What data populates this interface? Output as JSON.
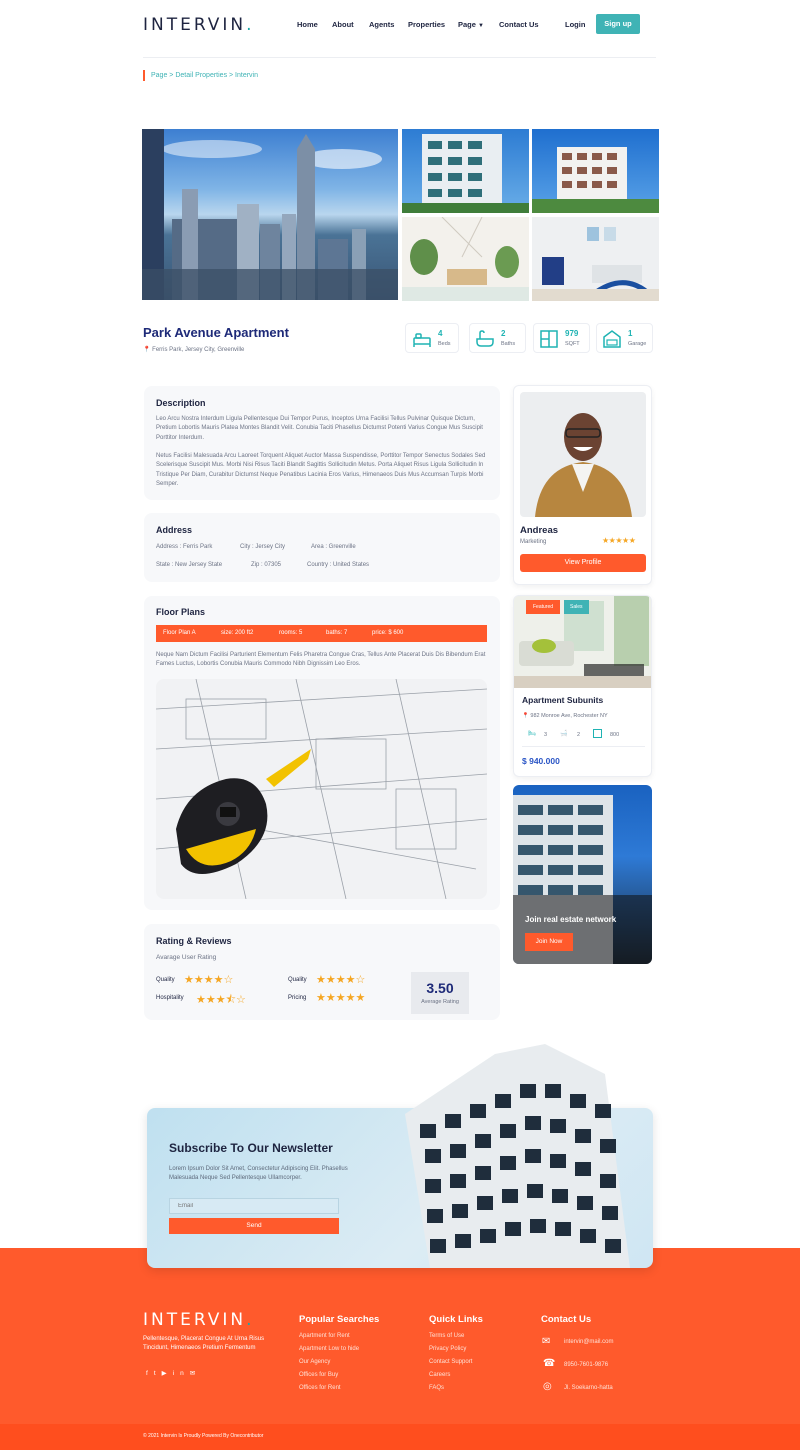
{
  "header": {
    "logo": "INTERVIN",
    "logo_dot": ".",
    "nav": [
      "Home",
      "About",
      "Agents",
      "Properties",
      "Page",
      "Contact Us"
    ],
    "login": "Login",
    "signup": "Sign up"
  },
  "breadcrumb": "Page > Detail Properties > Intervin",
  "property": {
    "title": "Park Avenue Apartment",
    "location": "Ferris Park, Jersey City, Greenville",
    "features": [
      {
        "value": "4",
        "label": "Beds",
        "icon": "bed-icon"
      },
      {
        "value": "2",
        "label": "Baths",
        "icon": "bath-icon"
      },
      {
        "value": "979",
        "label": "SQFT",
        "icon": "area-icon"
      },
      {
        "value": "1",
        "label": "Garage",
        "icon": "garage-icon"
      }
    ]
  },
  "description": {
    "title": "Description",
    "p1": "Leo Arcu Nostra Interdum Ligula Pellentesque Dui Tempor Purus, Inceptos Urna Facilisi Tellus Pulvinar Quisque Dictum, Pretium Lobortis Mauris Platea Montes Blandit Velit. Conubia Taciti Phasellus Dictumst Potenti Varius Congue Mus Suscipit Porttitor Interdum.",
    "p2": "Netus Facilisi Malesuada Arcu Laoreet Torquent Aliquet Auctor Massa Suspendisse, Porttitor Tempor Senectus Sodales Sed Scelerisque Suscipit Mus. Morbi Nisi Risus Taciti Blandit Sagittis Sollicitudin Metus. Porta Aliquet Risus Ligula Sollicitudin In Tristique Per Diam, Curabitur Dictumst Neque Penatibus Lacinia Eros Varius, Himenaeos Duis Mus Accumsan Turpis Morbi Semper."
  },
  "address": {
    "title": "Address",
    "row1": [
      "Address : Ferris Park",
      "City : Jersey City",
      "Area : Greenville"
    ],
    "row2": [
      "State : New Jersey State",
      "Zip : 07305",
      "Country : United States"
    ]
  },
  "floor": {
    "title": "Floor Plans",
    "bar": [
      "Floor Plan A",
      "size: 200 ft2",
      "rooms: 5",
      "baths: 7",
      "price: $ 600"
    ],
    "text": "Neque Nam Dictum Facilisi Parturient Elementum Felis Pharetra Congue Cras, Tellus Ante Placerat Duis Dis Bibendum Erat Fames Luctus, Lobortis Conubia Mauris Commodo Nibh Dignissim Leo Eros."
  },
  "rating": {
    "title": "Rating & Reviews",
    "subtitle": "Avarage User Rating",
    "items": [
      {
        "label": "Quality",
        "value": 4
      },
      {
        "label": "Quality",
        "value": 4
      },
      {
        "label": "Hospitality",
        "value": 3.5
      },
      {
        "label": "Pricing",
        "value": 5
      }
    ],
    "score": "3.50",
    "score_label": "Average Rating"
  },
  "agent": {
    "name": "Andreas",
    "role": "Marketing",
    "stars": 5,
    "button": "View Profile"
  },
  "listing": {
    "badge1": "Featured",
    "badge2": "Sales",
    "title": "Apartment Subunits",
    "location": "982 Monroe Ave, Rochester NY",
    "beds": "3",
    "baths": "2",
    "area": "800",
    "price": "$ 940.000"
  },
  "join": {
    "title": "Join real estate network",
    "button": "Join Now"
  },
  "newsletter": {
    "title": "Subscribe To Our Newsletter",
    "text": "Lorem Ipsum Dolor Sit Amet, Consectetur Adipiscing Elit. Phasellus Malesuada Neque Sed Pellentesque Ullamcorper.",
    "placeholder": "Email",
    "button": "Send"
  },
  "footer": {
    "logo": "INTERVIN",
    "logo_dot": ".",
    "about": "Pellentesque, Placerat Congue At Urna Risus Tincidunt, Himenaeos Pretium Fermentum",
    "popular_title": "Popular Searches",
    "popular": [
      "Apartment for Rent",
      "Apartment Low to hide",
      "Our Agency",
      "Offices for Buy",
      "Offices for Rent"
    ],
    "quick_title": "Quick Links",
    "quick": [
      "Terms of Use",
      "Privacy Policy",
      "Contact Support",
      "Careers",
      "FAQs"
    ],
    "contact_title": "Contact Us",
    "email": "intervin@mail.com",
    "phone": "8950-7601-9876",
    "address": "Jl. Soekarno-hatta",
    "copyright": "© 2021 Intervin Is Proudly Powered By Onecontributor"
  },
  "colors": {
    "accent": "#ff5a2c",
    "teal": "#3fb3b5",
    "navy": "#1e2440"
  }
}
